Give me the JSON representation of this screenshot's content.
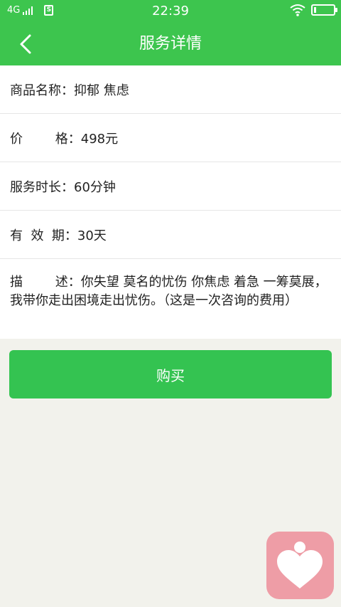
{
  "status_bar": {
    "network": "4G",
    "time": "22:39",
    "battery_level": 0.1
  },
  "header": {
    "title": "服务详情"
  },
  "details": {
    "name_label": "商品名称：",
    "name_value": "抑郁 焦虑",
    "price_label": "价        格：",
    "price_value": "498元",
    "duration_label": "服务时长：",
    "duration_value": "60分钟",
    "validity_label": "有  效  期：",
    "validity_value": "30天",
    "desc_label": "描        述：",
    "desc_value": "你失望 莫名的忧伤   你焦虑 着急  一筹莫展，我带你走出困境走出忧伤。（这是一次咨询的费用）"
  },
  "actions": {
    "buy_label": "购买"
  },
  "colors": {
    "primary": "#3dc54e",
    "button": "#34c351",
    "float_icon_bg": "#ee9da6"
  },
  "icons": {
    "back": "chevron-left-icon",
    "wifi": "wifi-icon",
    "battery": "battery-icon",
    "sim": "sim-card-icon",
    "signal": "signal-bars-icon",
    "float": "heart-person-icon"
  }
}
